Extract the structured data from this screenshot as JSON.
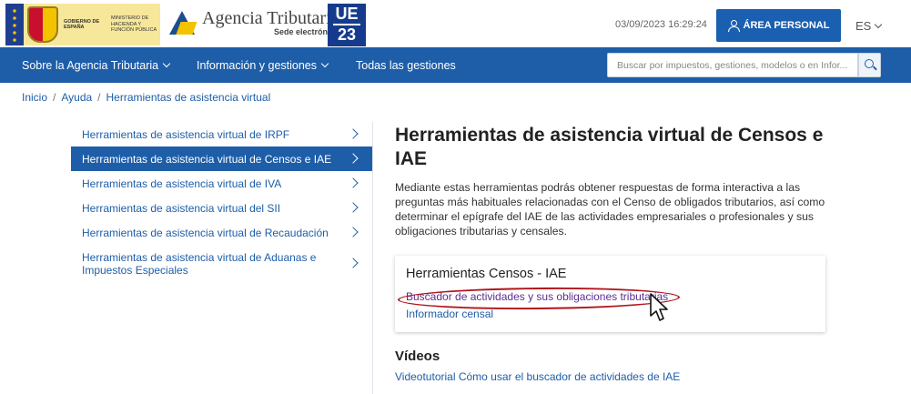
{
  "header": {
    "gov_logo": {
      "line1": "Gobierno de España",
      "line2": "Ministerio de Hacienda y Función Pública"
    },
    "brand": {
      "title": "Agencia Tributaria",
      "subtitle": "Sede electrónica"
    },
    "eu_badge": {
      "top": "UE",
      "bottom": "23"
    },
    "datetime": "03/09/2023 16:29:24",
    "area_personal_label": "ÁREA PERSONAL",
    "language": "ES"
  },
  "nav": {
    "items": [
      {
        "label": "Sobre la Agencia Tributaria",
        "has_dropdown": true
      },
      {
        "label": "Información y gestiones",
        "has_dropdown": true
      },
      {
        "label": "Todas las gestiones",
        "has_dropdown": false
      }
    ],
    "search": {
      "placeholder": "Buscar por impuestos, gestiones, modelos o en Infor..."
    }
  },
  "breadcrumb": {
    "items": [
      "Inicio",
      "Ayuda",
      "Herramientas de asistencia virtual"
    ],
    "separator": "/"
  },
  "sidebar": {
    "items": [
      {
        "label": "Herramientas de asistencia virtual de IRPF",
        "active": false
      },
      {
        "label": "Herramientas de asistencia virtual de Censos e IAE",
        "active": true
      },
      {
        "label": "Herramientas de asistencia virtual de IVA",
        "active": false
      },
      {
        "label": "Herramientas de asistencia virtual del SII",
        "active": false
      },
      {
        "label": "Herramientas de asistencia virtual de Recaudación",
        "active": false
      },
      {
        "label": "Herramientas de asistencia virtual de Aduanas e Impuestos Especiales",
        "active": false
      }
    ]
  },
  "main": {
    "title": "Herramientas de asistencia virtual de Censos e IAE",
    "description": "Mediante estas herramientas podrás obtener respuestas de forma interactiva a las preguntas más habituales relacionadas con el Censo de obligados tributarios, así como determinar el epígrafe del IAE de las actividades empresariales o profesionales y sus obligaciones tributarias y censales.",
    "card": {
      "title": "Herramientas Censos - IAE",
      "links": [
        "Buscador de actividades y sus obligaciones tributarias",
        "Informador censal"
      ]
    },
    "videos": {
      "title": "Vídeos",
      "link": "Videotutorial Cómo usar el buscador de actividades de IAE"
    }
  },
  "colors": {
    "primary_blue": "#1e5ea8",
    "button_blue": "#1b5fb0",
    "visited_link": "#5b2e8f",
    "annotation_red": "#b0151b"
  }
}
